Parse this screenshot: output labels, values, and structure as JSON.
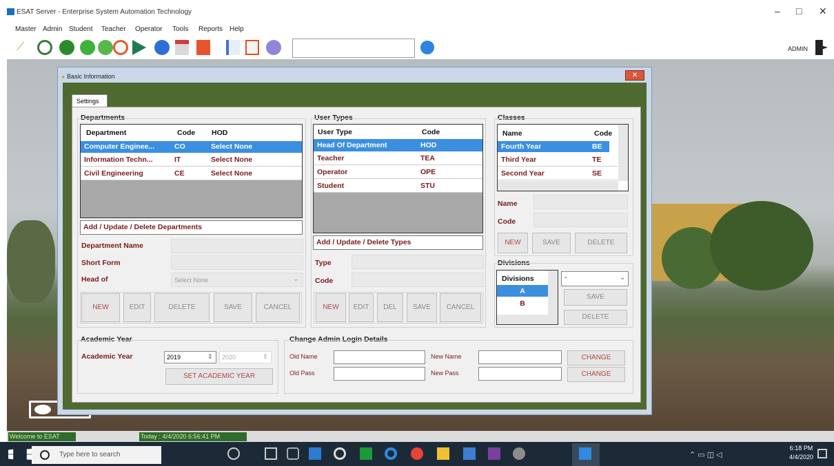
{
  "window": {
    "title": "ESAT Server - Enterprise System Automation Technology",
    "minimize": "–",
    "maximize": "□",
    "close": "✕"
  },
  "menu": [
    "Master",
    "Admin",
    "Student",
    "Teacher",
    "Operator",
    "Tools",
    "Reports",
    "Help"
  ],
  "toolbar": {
    "user": "ADMIN",
    "search_value": ""
  },
  "dialog": {
    "title": "Basic Information",
    "close": "✕",
    "tab": "Settings",
    "departments": {
      "group_label": "Departments",
      "columns": [
        "Department",
        "Code",
        "HOD"
      ],
      "rows": [
        {
          "department": "Computer Enginee...",
          "code": "CO",
          "hod": "Select None",
          "selected": true
        },
        {
          "department": "Information Techn...",
          "code": "IT",
          "hod": "Select None",
          "selected": false
        },
        {
          "department": "Civil Engineering",
          "code": "CE",
          "hod": "Select None",
          "selected": false
        }
      ],
      "manage_link": "Add / Update / Delete Departments",
      "name_label": "Department Name",
      "short_label": "Short Form",
      "head_label": "Head of",
      "head_select": "Select None",
      "buttons": {
        "new": "NEW",
        "edit": "EDIT",
        "delete": "DELETE",
        "save": "SAVE",
        "cancel": "CANCEL"
      }
    },
    "user_types": {
      "group_label": "User Types",
      "columns": [
        "User Type",
        "Code"
      ],
      "rows": [
        {
          "type": "Head Of Department",
          "code": "HOD",
          "selected": true
        },
        {
          "type": "Teacher",
          "code": "TEA",
          "selected": false
        },
        {
          "type": "Operator",
          "code": "OPE",
          "selected": false
        },
        {
          "type": "Student",
          "code": "STU",
          "selected": false
        }
      ],
      "manage_link": "Add / Update / Delete Types",
      "type_label": "Type",
      "code_label": "Code",
      "buttons": {
        "new": "NEW",
        "edit": "EDIT",
        "del": "DEL",
        "save": "SAVE",
        "cancel": "CANCEL"
      }
    },
    "classes": {
      "group_label": "Classes",
      "columns": [
        "Name",
        "Code"
      ],
      "rows": [
        {
          "name": "Fourth Year",
          "code": "BE",
          "selected": true
        },
        {
          "name": "Third Year",
          "code": "TE",
          "selected": false
        },
        {
          "name": "Second Year",
          "code": "SE",
          "selected": false
        }
      ],
      "name_label": "Name",
      "code_label": "Code",
      "buttons": {
        "new": "NEW",
        "save": "SAVE",
        "delete": "DELETE"
      }
    },
    "divisions": {
      "group_label": "Divisions",
      "column": "Divisions",
      "rows": [
        {
          "name": "A",
          "selected": true
        },
        {
          "name": "B",
          "selected": false
        }
      ],
      "select_value": "-",
      "buttons": {
        "save": "SAVE",
        "delete": "DELETE"
      }
    },
    "academic_year": {
      "group_label": "Academic Year",
      "label": "Academic Year",
      "from": "2019",
      "to": "2020",
      "button": "SET ACADEMIC YEAR"
    },
    "admin_login": {
      "group_label": "Change Admin Login Details",
      "old_name": "Old Name",
      "old_pass": "Old Pass",
      "new_name": "New Name",
      "new_pass": "New Pass",
      "change1": "CHANGE",
      "change2": "CHANGE"
    }
  },
  "status": {
    "welcome": "Welcome to ESAT",
    "today": "Today : 4/4/2020 6:56:41 PM"
  },
  "taskbar": {
    "search_placeholder": "Type here to search",
    "time": "6:18 PM",
    "date": "4/4/2020"
  }
}
